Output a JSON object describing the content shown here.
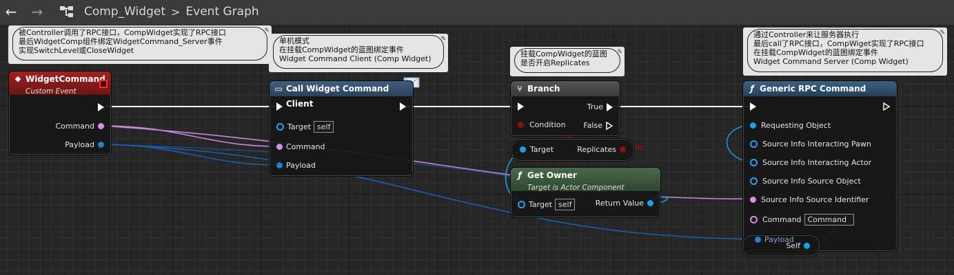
{
  "toolbar": {
    "back_icon": "←",
    "forward_icon": "→",
    "graph_icon": "graph-icon",
    "breadcrumb_root": "Comp_Widget",
    "breadcrumb_sep": ">",
    "breadcrumb_current": "Event Graph"
  },
  "comments": {
    "c1": {
      "lines": [
        "被Controller调用了RPC接口，CompWidget实现了RPC接口",
        "最后WidgetComp组件绑定WidgetCommand_Server事件",
        "实现SwitchLevel或CloseWidget"
      ]
    },
    "c2": {
      "lines": [
        "单机模式",
        "在挂载CompWidget的蓝图绑定事件",
        "Widget Command Client (Comp Widget)"
      ]
    },
    "c3": {
      "lines": [
        "挂载CompWidget的蓝图",
        "是否开启Replicates"
      ]
    },
    "c4": {
      "lines": [
        "通过Controller来让服务器执行",
        "最后call了RPC接口，CompWiget实现了RPC接口",
        "在挂载CompWidget的蓝图绑定事件",
        "Widget Command Server (Comp Widget)"
      ]
    }
  },
  "nodes": {
    "widget_command": {
      "title": "WidgetCommand",
      "subtitle": "Custom Event",
      "pin_command": "Command",
      "pin_payload": "Payload",
      "color": "#8c1b1b"
    },
    "call_client": {
      "title": "Call Widget Command Client",
      "pin_target": "Target",
      "target_value": "self",
      "pin_command": "Command",
      "pin_payload": "Payload"
    },
    "branch": {
      "title": "Branch",
      "pin_condition": "Condition",
      "pin_true": "True",
      "pin_false": "False"
    },
    "replicates": {
      "pin_target": "Target",
      "pin_replicates": "Replicates"
    },
    "get_owner": {
      "title": "Get Owner",
      "subtitle": "Target is Actor Component",
      "pin_target": "Target",
      "target_value": "self",
      "pin_return": "Return Value",
      "color": "#3d5a3d"
    },
    "generic_rpc": {
      "title": "Generic RPC Command",
      "pins": [
        "Requesting Object",
        "Source Info Interacting Pawn",
        "Source Info Interacting Actor",
        "Source Info Source Object",
        "Source Info Source Identifier"
      ],
      "pin_command": "Command",
      "command_value": "Command",
      "pin_payload": "Payload",
      "color": "#2b4a63"
    },
    "self_node": {
      "pin_self": "Self"
    }
  },
  "colors": {
    "exec": "#ffffff",
    "struct_pin": "#d88fe8",
    "object_pin": "#1e7fd6",
    "bool_pin": "#8a0f0f",
    "object_ref": "#00a8f0"
  }
}
